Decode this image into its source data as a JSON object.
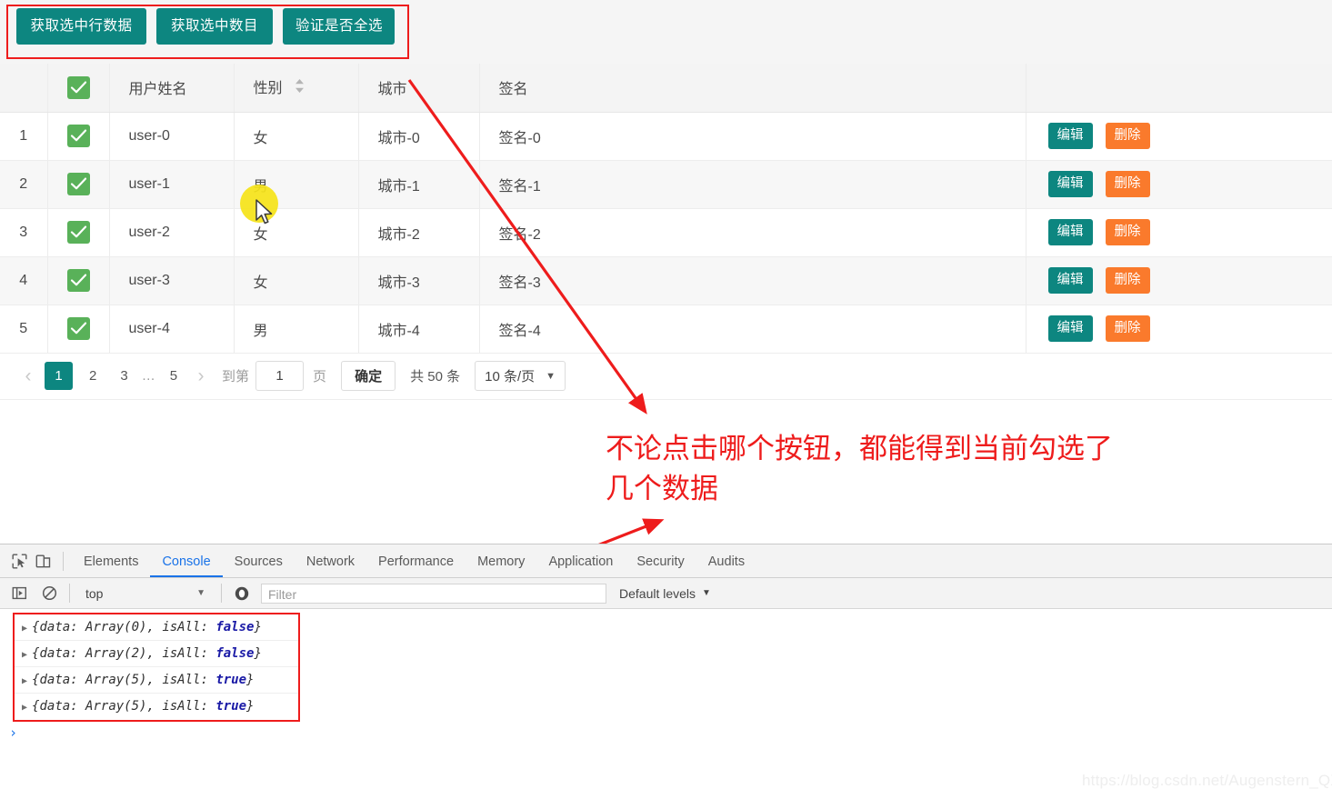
{
  "toolbar": {
    "buttons": [
      {
        "label": "获取选中行数据",
        "name": "get-selected-rows-button"
      },
      {
        "label": "获取选中数目",
        "name": "get-selected-count-button"
      },
      {
        "label": "验证是否全选",
        "name": "verify-all-selected-button"
      }
    ],
    "highlight_color": "#ee1c1c",
    "button_color": "#0d8680"
  },
  "table": {
    "headers": {
      "index": "",
      "checkbox": "",
      "name": "用户姓名",
      "gender": "性别",
      "city": "城市",
      "signature": "签名",
      "action": ""
    },
    "header_all_checked": true,
    "rows": [
      {
        "index": "1",
        "checked": true,
        "name": "user-0",
        "gender": "女",
        "city": "城市-0",
        "signature": "签名-0",
        "edit": "编辑",
        "delete": "删除"
      },
      {
        "index": "2",
        "checked": true,
        "name": "user-1",
        "gender": "男",
        "city": "城市-1",
        "signature": "签名-1",
        "edit": "编辑",
        "delete": "删除"
      },
      {
        "index": "3",
        "checked": true,
        "name": "user-2",
        "gender": "女",
        "city": "城市-2",
        "signature": "签名-2",
        "edit": "编辑",
        "delete": "删除"
      },
      {
        "index": "4",
        "checked": true,
        "name": "user-3",
        "gender": "女",
        "city": "城市-3",
        "signature": "签名-3",
        "edit": "编辑",
        "delete": "删除"
      },
      {
        "index": "5",
        "checked": true,
        "name": "user-4",
        "gender": "男",
        "city": "城市-4",
        "signature": "签名-4",
        "edit": "编辑",
        "delete": "删除"
      }
    ],
    "checkbox_color": "#59b159",
    "edit_color": "#0d8680",
    "delete_color": "#fa7a2c"
  },
  "pagination": {
    "prev_icon": "‹",
    "next_icon": "›",
    "pages": [
      "1",
      "2",
      "3"
    ],
    "ellipsis": "…",
    "last_page": "5",
    "current_page": "1",
    "jump_label": "到第",
    "jump_value": "1",
    "page_unit": "页",
    "confirm_label": "确定",
    "total_label": "共 50 条",
    "page_size_label": "10 条/页",
    "page_size_caret": "▼"
  },
  "annotation": {
    "line1": "不论点击哪个按钮，都能得到当前勾选了",
    "line2": "几个数据",
    "color": "#ee1c1c"
  },
  "devtools": {
    "tabs": [
      {
        "label": "Elements",
        "active": false
      },
      {
        "label": "Console",
        "active": true
      },
      {
        "label": "Sources",
        "active": false
      },
      {
        "label": "Network",
        "active": false
      },
      {
        "label": "Performance",
        "active": false
      },
      {
        "label": "Memory",
        "active": false
      },
      {
        "label": "Application",
        "active": false
      },
      {
        "label": "Security",
        "active": false
      },
      {
        "label": "Audits",
        "active": false
      }
    ],
    "context": "top",
    "context_caret": "▼",
    "filter_placeholder": "Filter",
    "levels_label": "Default levels",
    "levels_caret": "▼",
    "prompt": "›",
    "logs": [
      {
        "triangle": "▶",
        "prefix": "{data: Array(0), isAll: ",
        "value": "false",
        "suffix": "}"
      },
      {
        "triangle": "▶",
        "prefix": "{data: Array(2), isAll: ",
        "value": "false",
        "suffix": "}"
      },
      {
        "triangle": "▶",
        "prefix": "{data: Array(5), isAll: ",
        "value": "true",
        "suffix": "}"
      },
      {
        "triangle": "▶",
        "prefix": "{data: Array(5), isAll: ",
        "value": "true",
        "suffix": "}"
      }
    ]
  },
  "watermark": "https://blog.csdn.net/Augenstern_QXL"
}
